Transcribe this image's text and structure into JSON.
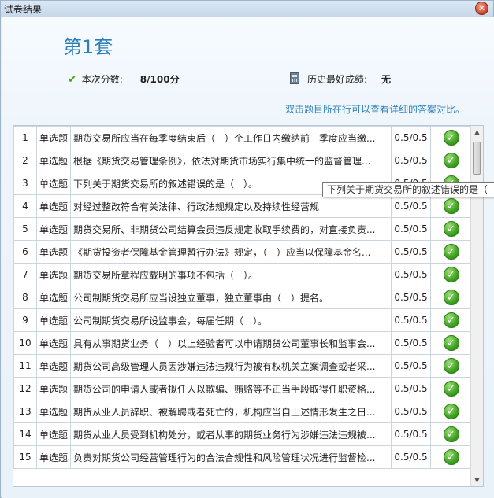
{
  "window": {
    "title": "试卷结果",
    "close_symbol": "✕"
  },
  "header": {
    "set_title": "第1套",
    "score_label": "本次分数:",
    "score_value": "8/100分",
    "best_label": "历史最好成绩:",
    "best_value": "无",
    "hint": "双击题目所在行可以查看详细的答案对比。"
  },
  "icons": {
    "check": "check-icon",
    "calculator": "calculator-icon",
    "correct": "correct-icon"
  },
  "colors": {
    "title_blue": "#2b7fb9",
    "correct_green": "#3fa321"
  },
  "rows": [
    {
      "num": "1",
      "type": "单选题",
      "question": "期货交易所应当在每季度结束后（　）个工作日内缴纳前一季度应当缴...",
      "score": "0.5/0.5"
    },
    {
      "num": "2",
      "type": "单选题",
      "question": "根据《期货交易管理条例》，依法对期货市场实行集中统一的监督管理...",
      "score": "0.5/0.5"
    },
    {
      "num": "3",
      "type": "单选题",
      "question": "下列关于期货交易所的叙述错误的是（　）。",
      "score": "0.5/0.5"
    },
    {
      "num": "4",
      "type": "单选题",
      "question": "对经过整改符合有关法律、行政法规规定以及持续性经营规",
      "score": "0.5/0.5"
    },
    {
      "num": "5",
      "type": "单选题",
      "question": "期货交易所、非期货公司结算会员违反规定收取手续费的，对直接负责...",
      "score": "0.5/0.5"
    },
    {
      "num": "6",
      "type": "单选题",
      "question": "《期货投资者保障基金管理暂行办法》规定，（　）应当以保障基金名...",
      "score": "0.5/0.5"
    },
    {
      "num": "7",
      "type": "单选题",
      "question": "期货交易所章程应载明的事项不包括（　）。",
      "score": "0.5/0.5"
    },
    {
      "num": "8",
      "type": "单选题",
      "question": "公司制期货交易所应当设独立董事，独立董事由（　）提名。",
      "score": "0.5/0.5"
    },
    {
      "num": "9",
      "type": "单选题",
      "question": "公司制期货交易所设监事会，每届任期（　）。",
      "score": "0.5/0.5"
    },
    {
      "num": "10",
      "type": "单选题",
      "question": "具有从事期货业务（　）以上经验者可以申请期货公司董事长和监事会...",
      "score": "0.5/0.5"
    },
    {
      "num": "11",
      "type": "单选题",
      "question": "期货公司高级管理人员因涉嫌违法违规行为被有权机关立案调查或者采...",
      "score": "0.5/0.5"
    },
    {
      "num": "12",
      "type": "单选题",
      "question": "期货公司的申请人或者拟任人以欺骗、贿赂等不正当手段取得任职资格...",
      "score": "0.5/0.5"
    },
    {
      "num": "13",
      "type": "单选题",
      "question": "期货从业人员辞职、被解聘或者死亡的，机构应当自上述情形发生之日...",
      "score": "0.5/0.5"
    },
    {
      "num": "14",
      "type": "单选题",
      "question": "期货从业人员受到机构处分，或者从事的期货业务行为涉嫌违法违规被...",
      "score": "0.5/0.5"
    },
    {
      "num": "15",
      "type": "单选题",
      "question": "负责对期货公司经营管理行为的合法合规性和风险管理状况进行监督检...",
      "score": "0.5/0.5"
    }
  ],
  "tooltip": {
    "text": "下列关于期货交易所的叙述错误的是（"
  }
}
